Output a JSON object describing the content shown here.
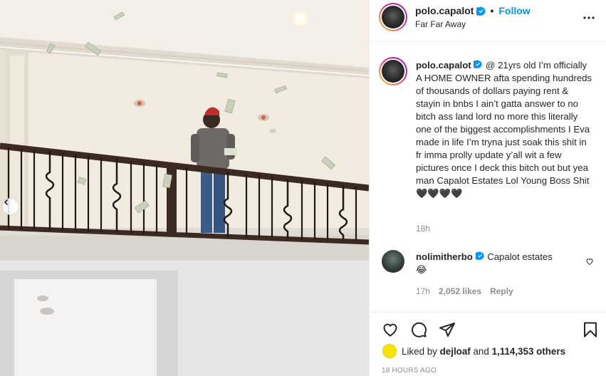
{
  "post": {
    "image_alt": "",
    "carousel": {
      "prev_icon": "chevron-left-icon"
    }
  },
  "header": {
    "username": "polo.capalot",
    "verified_icon": "verified-badge-icon",
    "separator": "•",
    "follow_label": "Follow",
    "location": "Far Far Away",
    "more_icon": "more-options-icon"
  },
  "caption": {
    "username": "polo.capalot",
    "text": "@ 21yrs old I’m officially A HOME OWNER afta spending hundreds of thousands of dollars paying rent & stayin in bnbs I ain’t gatta answer to no bitch ass land lord no more this literally one of the biggest accomplishments I Eva made in life I’m tryna just soak this shit in fr imma prolly update y’all wit a few pictures once I deck this bitch out but yea man Capalot Estates Lol Young Boss Shit🖤🖤🖤🖤",
    "time": "18h"
  },
  "comment": {
    "username": "nolimitherbo",
    "text": "Capalot estates",
    "emoji": "😂",
    "time": "17h",
    "likes": "2,052 likes",
    "reply_label": "Reply"
  },
  "actions": {
    "like_icon": "heart-icon",
    "comment_icon": "comment-icon",
    "share_icon": "share-icon",
    "save_icon": "bookmark-icon"
  },
  "likes": {
    "prefix": "Liked by ",
    "user": "dejloaf",
    "middle": " and ",
    "count": "1,114,353 others"
  },
  "timestamp": "18 HOURS AGO",
  "colors": {
    "accent": "#0095f6",
    "secondary_text": "#8e8e8e",
    "text": "#262626"
  }
}
